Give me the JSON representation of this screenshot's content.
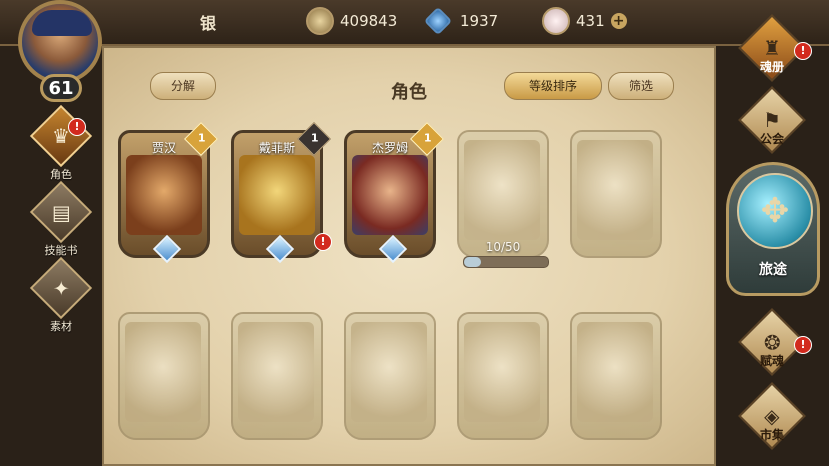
{
  "player": {
    "name": "银",
    "level": "61"
  },
  "resources": [
    {
      "icon": "gold-coin-icon",
      "value": "409843"
    },
    {
      "icon": "blue-crystal-icon",
      "value": "1937"
    },
    {
      "icon": "pink-gem-icon",
      "value": "431"
    }
  ],
  "plus_label": "+",
  "left_nav": [
    {
      "label": "角色",
      "icon": "helmet-icon",
      "alert": "!"
    },
    {
      "label": "技能书",
      "icon": "book-icon"
    },
    {
      "label": "素材",
      "icon": "material-icon"
    }
  ],
  "panel": {
    "title": "角色",
    "decompose_label": "分解",
    "sort_label": "等级排序",
    "filter_label": "筛选"
  },
  "cards_owned": [
    {
      "name": "贾汉",
      "stars": "1",
      "alert": ""
    },
    {
      "name": "戴菲斯",
      "stars": "1",
      "alert": "!"
    },
    {
      "name": "杰罗姆",
      "stars": "1",
      "alert": ""
    }
  ],
  "locked_progress": {
    "text": "10/50",
    "fraction": 0.2
  },
  "right_nav": [
    {
      "label": "魂册",
      "icon": "soul-book-icon",
      "alert": "!"
    },
    {
      "label": "公会",
      "icon": "guild-icon"
    },
    {
      "label": "旅途",
      "icon": "journey-icon"
    },
    {
      "label": "赋魂",
      "icon": "infuse-icon",
      "alert": "!"
    },
    {
      "label": "市集",
      "icon": "market-icon"
    }
  ],
  "colors": {
    "accent_gold": "#d8a33a",
    "alert_red": "#d22a1e",
    "parchment": "#e3d1ab"
  }
}
